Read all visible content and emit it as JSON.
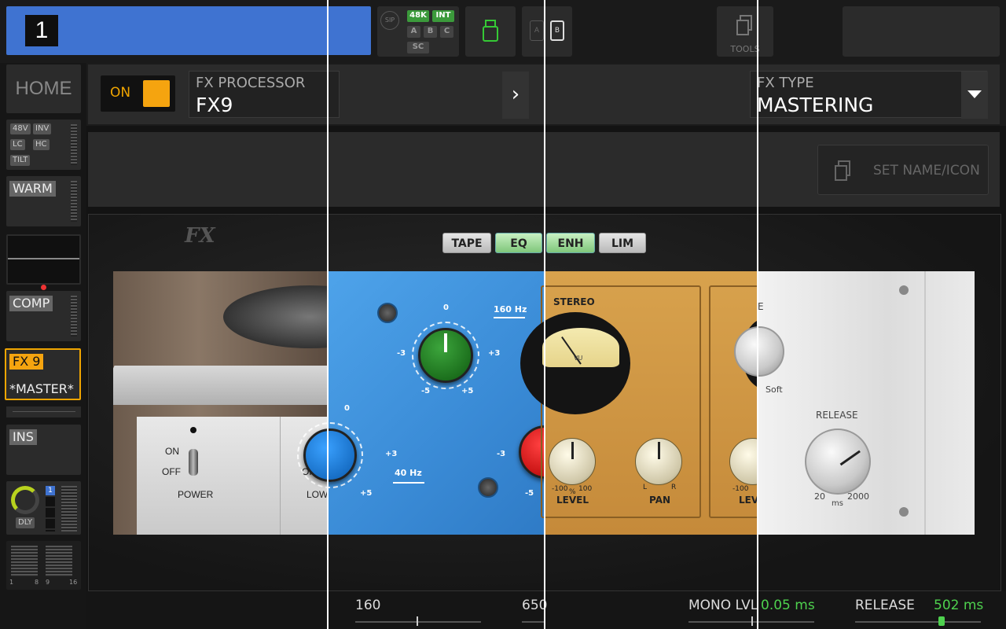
{
  "channel": {
    "number": "1"
  },
  "status": {
    "sip": "SIP",
    "rate_48k": "48K",
    "int": "INT",
    "a": "A",
    "b": "B",
    "c": "C",
    "sc": "SC",
    "card_a": "A",
    "card_b": "B"
  },
  "tools": {
    "label": "TOOLS"
  },
  "sidebar": {
    "home": "HOME",
    "tags": [
      "48V",
      "INV",
      "LC",
      "HC",
      "TILT"
    ],
    "warm": "WARM",
    "comp": "COMP",
    "fx9": "FX 9",
    "master": "*MASTER*",
    "ins": "INS",
    "dly": "DLY",
    "dly_badge": "1",
    "meter_labels": [
      "1",
      "8",
      "9",
      "16"
    ]
  },
  "header": {
    "on_label": "ON",
    "fx_processor_label": "FX PROCESSOR",
    "fx_processor_value": "FX9",
    "fx_type_label": "FX TYPE",
    "fx_type_value": "MASTERING",
    "set_name": "SET NAME/ICON"
  },
  "tabs": [
    {
      "label": "TAPE",
      "active": false
    },
    {
      "label": "EQ",
      "active": true
    },
    {
      "label": "ENH",
      "active": true
    },
    {
      "label": "LIM",
      "active": false
    }
  ],
  "logo": "FX",
  "tape": {
    "on": "ON",
    "off": "OFF",
    "power": "POWER",
    "on2": "ON",
    "off2": "OFF",
    "low": "LOW"
  },
  "eq": {
    "freq1": "160 Hz",
    "freq2": "40 Hz",
    "k1_0": "0",
    "k1_m3": "-3",
    "k1_p3": "+3",
    "k1_m5": "-5",
    "k1_p5": "+5",
    "k2_0": "0",
    "k2_p3": "+3",
    "k2_p5": "+5",
    "k3_m3": "-3",
    "k3_m5": "-5"
  },
  "enh": {
    "stereo": "STEREO",
    "vu": "VU",
    "level": "LEVEL",
    "pan": "PAN",
    "lvl_min": "-100",
    "lvl_unit": "%",
    "lvl_max": "100",
    "pan_l": "L",
    "pan_r": "R",
    "level2": "LEV",
    "lvl2_min": "-100"
  },
  "lim": {
    "soft": "Soft",
    "release": "RELEASE",
    "min": "20",
    "max": "2000",
    "unit": "ms",
    "e": "E"
  },
  "bottom": {
    "v160": "160",
    "v650": "650",
    "mono_lvl": "MONO LVL",
    "mono_val": "0.05 ms",
    "release": "RELEASE",
    "release_val": "502 ms"
  },
  "colors": {
    "accent": "#f5a40f",
    "channel": "#3f73d1",
    "green": "#4ed14e"
  }
}
